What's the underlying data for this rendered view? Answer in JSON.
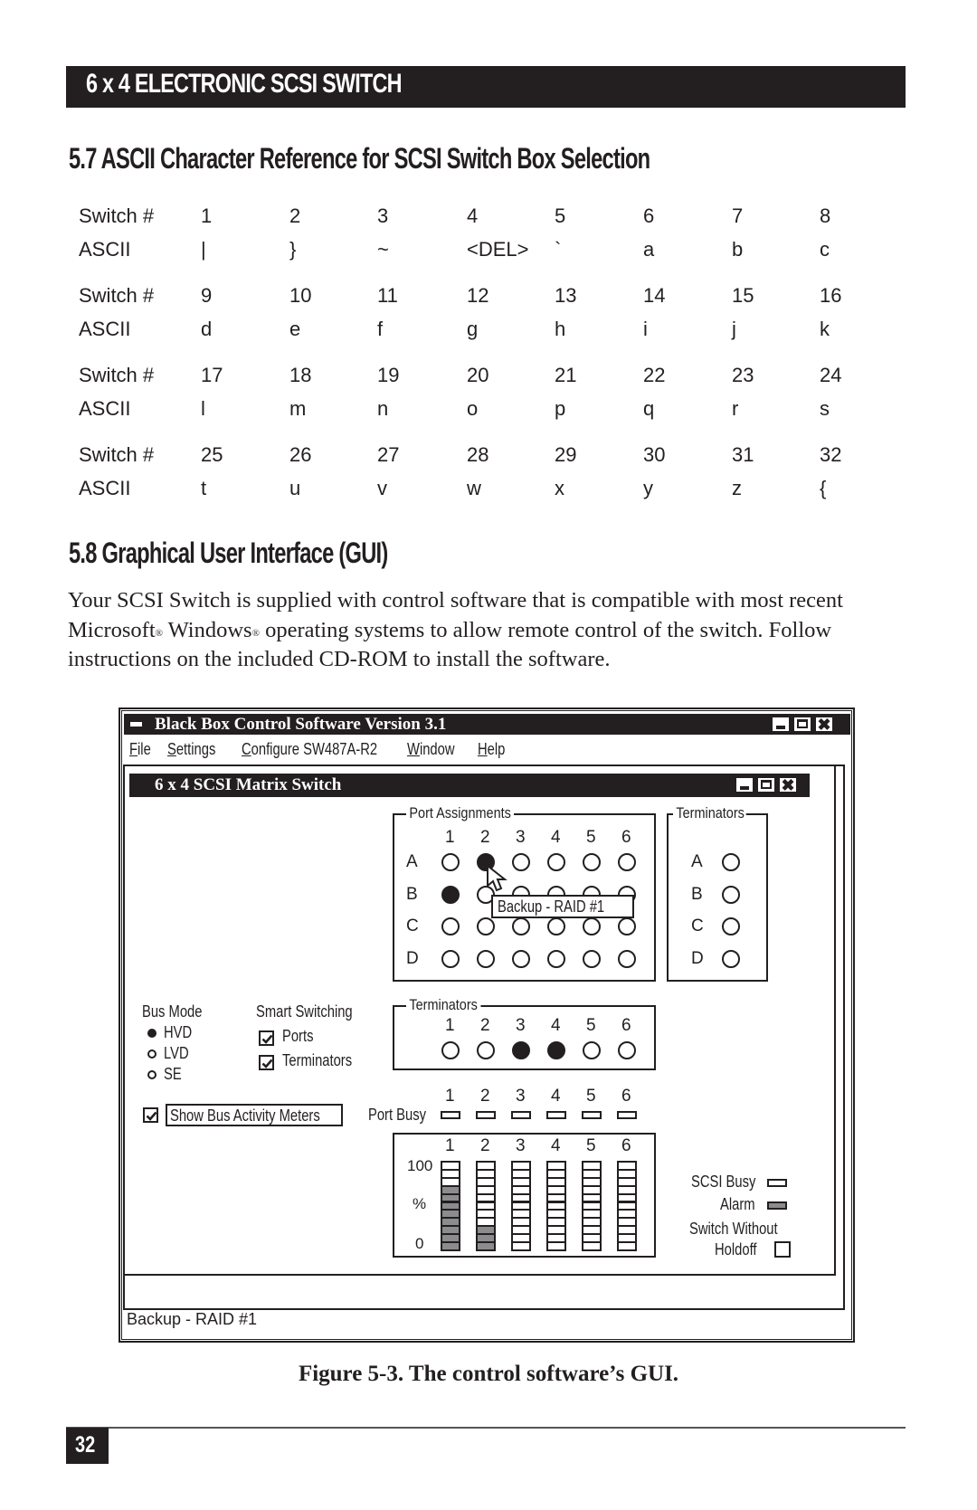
{
  "header": {
    "title": "6 x 4 ELECTRONIC SCSI SWITCH"
  },
  "section_57": {
    "heading": "5.7 ASCII Character Reference for SCSI Switch Box Selection",
    "row_label_switch": "Switch #",
    "row_label_ascii": "ASCII",
    "groups": [
      {
        "switch": [
          "1",
          "2",
          "3",
          "4",
          "5",
          "6",
          "7",
          "8"
        ],
        "ascii": [
          "|",
          "}",
          "~",
          "<DEL>",
          "`",
          "a",
          "b",
          "c"
        ]
      },
      {
        "switch": [
          "9",
          "10",
          "11",
          "12",
          "13",
          "14",
          "15",
          "16"
        ],
        "ascii": [
          "d",
          "e",
          "f",
          "g",
          "h",
          "i",
          "j",
          "k"
        ]
      },
      {
        "switch": [
          "17",
          "18",
          "19",
          "20",
          "21",
          "22",
          "23",
          "24"
        ],
        "ascii": [
          "l",
          "m",
          "n",
          "o",
          "p",
          "q",
          "r",
          "s"
        ]
      },
      {
        "switch": [
          "25",
          "26",
          "27",
          "28",
          "29",
          "30",
          "31",
          "32"
        ],
        "ascii": [
          "t",
          "u",
          "v",
          "w",
          "x",
          "y",
          "z",
          "{"
        ]
      }
    ]
  },
  "section_58": {
    "heading": "5.8 Graphical User Interface (GUI)",
    "para_1": "Your SCSI Switch is supplied with control software that is compatible with most recent Microsoft",
    "para_reg": "®",
    "para_2": " Windows",
    "para_3": " operating systems to allow remote control of the switch. Follow instructions on the included CD-ROM to install the software."
  },
  "gui": {
    "app_title": "Black Box Control Software Version 3.1",
    "menu": [
      {
        "key": "F",
        "rest": "ile"
      },
      {
        "key": "S",
        "rest": "ettings"
      },
      {
        "key": "C",
        "rest": "onfigure SW487A-R2"
      },
      {
        "key": "W",
        "rest": "indow"
      },
      {
        "key": "H",
        "rest": "elp"
      }
    ],
    "close_glyph": "✖",
    "child_title": "6 x 4 SCSI Matrix Switch",
    "port_assignments": {
      "legend": "Port Assignments",
      "columns": [
        "1",
        "2",
        "3",
        "4",
        "5",
        "6"
      ],
      "rows": [
        "A",
        "B",
        "C",
        "D"
      ],
      "selected": {
        "A": "2",
        "B": "1"
      },
      "tooltip": "Backup - RAID #1"
    },
    "terminators_side": {
      "legend": "Terminators",
      "rows": [
        "A",
        "B",
        "C",
        "D"
      ],
      "on": []
    },
    "bus_mode": {
      "label": "Bus Mode",
      "options": [
        "HVD",
        "LVD",
        "SE"
      ],
      "selected": "HVD"
    },
    "smart_switching": {
      "label": "Smart Switching",
      "options": [
        {
          "label": "Ports",
          "checked": true
        },
        {
          "label": "Terminators",
          "checked": true
        }
      ]
    },
    "terminators_bottom": {
      "legend": "Terminators",
      "columns": [
        "1",
        "2",
        "3",
        "4",
        "5",
        "6"
      ],
      "on": [
        "3",
        "4"
      ]
    },
    "show_meters": {
      "label": "Show Bus Activity Meters",
      "checked": true
    },
    "port_busy": {
      "label": "Port Busy",
      "columns": [
        "1",
        "2",
        "3",
        "4",
        "5",
        "6"
      ]
    },
    "meters": {
      "columns": [
        "1",
        "2",
        "3",
        "4",
        "5",
        "6"
      ],
      "axis_top": "100",
      "axis_mid": "%",
      "axis_bottom": "0",
      "segments_total": 11,
      "levels_segments": [
        8,
        3,
        0,
        0,
        0,
        0
      ]
    },
    "indicators": {
      "scsi_busy": "SCSI Busy",
      "alarm": "Alarm",
      "switch_without": "Switch Without",
      "holdoff": "Holdoff",
      "holdoff_checked": false
    },
    "status_bar": "Backup - RAID #1"
  },
  "caption": "Figure 5-3. The control software’s GUI.",
  "footer": {
    "page_number": "32"
  }
}
